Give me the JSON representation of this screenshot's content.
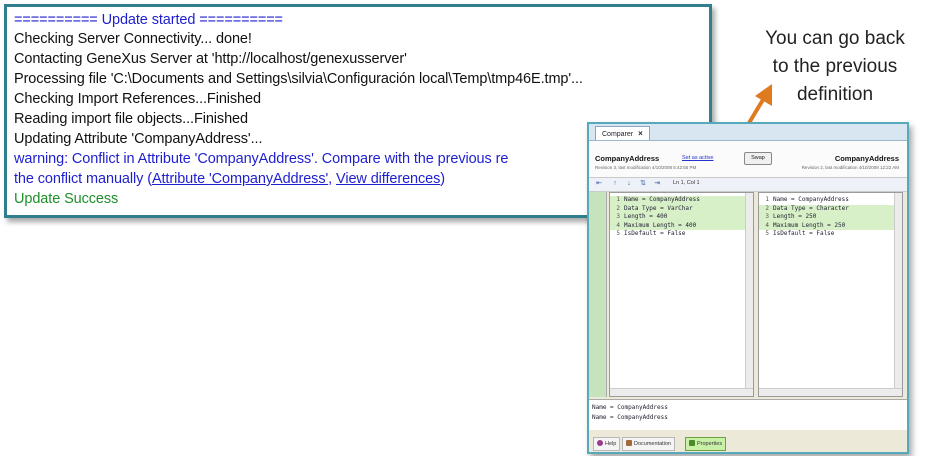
{
  "log": {
    "lines": [
      {
        "text": "========== Update started ==========",
        "style": "blue"
      },
      {
        "text": "Checking Server Connectivity... done!",
        "style": "normal"
      },
      {
        "text": "Contacting GeneXus Server at 'http://localhost/genexusserver'",
        "style": "normal"
      },
      {
        "text": "Processing file 'C:\\Documents and Settings\\silvia\\Configuración local\\Temp\\tmp46E.tmp'...",
        "style": "normal"
      },
      {
        "text": "Checking Import References...Finished",
        "style": "normal"
      },
      {
        "text": "Reading import file objects...Finished",
        "style": "normal"
      },
      {
        "text": "Updating Attribute 'CompanyAddress'...",
        "style": "normal"
      }
    ],
    "warning_line": "warning: Conflict in Attribute 'CompanyAddress'. Compare with the previous re",
    "conflict_prefix": "the conflict manually (",
    "link_attribute": "Attribute 'CompanyAddress'",
    "link_sep": ", ",
    "link_differences": "View differences",
    "conflict_suffix": ")",
    "success": "Update Success"
  },
  "annotation": {
    "lines": [
      "You can go back",
      "to the previous",
      "definition"
    ],
    "arrow_color": "#e07a1f"
  },
  "comparer": {
    "tab_label": "Comparer",
    "left_object": "CompanyAddress",
    "set_as_active": "Set as active",
    "swap_label": "Swap",
    "right_object": "CompanyAddress",
    "left_revision": "Revision 3, last modification 4/10/2008 5:42:55 PM",
    "right_revision": "Revision 2, last modification 4/10/2008 12:22 AM",
    "position": "Ln 1, Col 1",
    "left_rows": [
      {
        "n": "1",
        "text": "Name = CompanyAddress",
        "changed": true
      },
      {
        "n": "2",
        "text": "Data Type = VarChar",
        "changed": true
      },
      {
        "n": "3",
        "text": "Length = 400",
        "changed": true
      },
      {
        "n": "4",
        "text": "Maximum Length = 400",
        "changed": true
      },
      {
        "n": "5",
        "text": "IsDefault = False",
        "changed": false
      }
    ],
    "right_rows": [
      {
        "n": "1",
        "text": "Name = CompanyAddress",
        "changed": false
      },
      {
        "n": "2",
        "text": "Data Type = Character",
        "changed": true
      },
      {
        "n": "3",
        "text": "Length = 250",
        "changed": true
      },
      {
        "n": "4",
        "text": "Maximum Length = 250",
        "changed": true
      },
      {
        "n": "5",
        "text": "IsDefault = False",
        "changed": false
      }
    ],
    "bottom_lines": [
      "Name = CompanyAddress",
      "Name = CompanyAddress"
    ],
    "bottom_tabs": [
      "Help",
      "Documentation",
      "Properties"
    ],
    "accent": "#55a9bb"
  }
}
